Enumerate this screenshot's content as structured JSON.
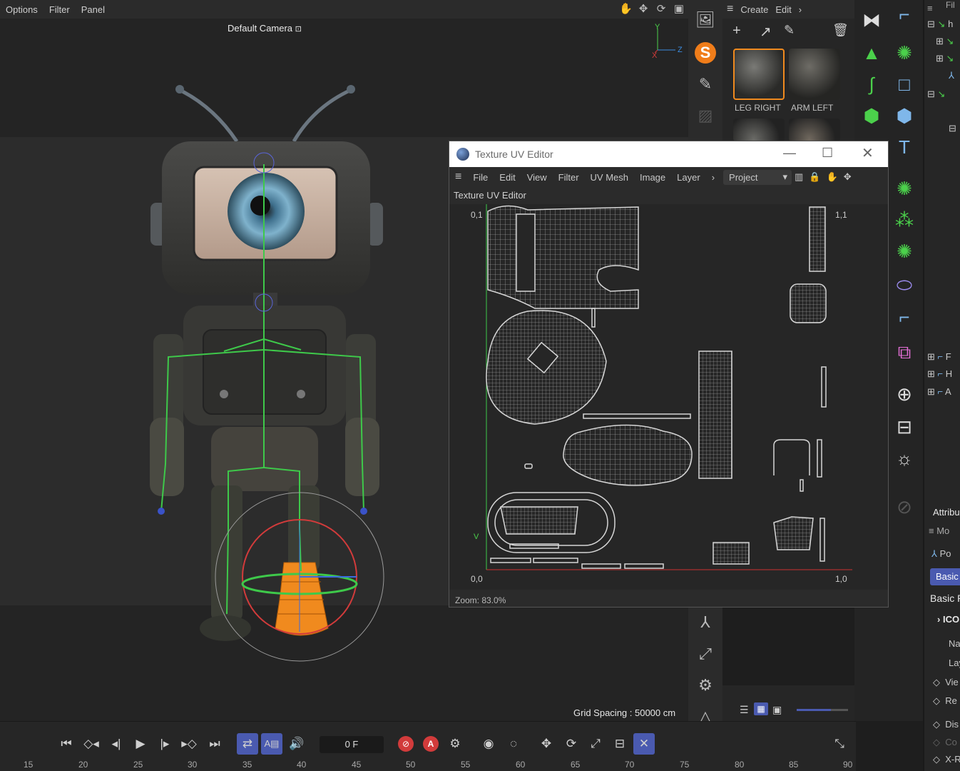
{
  "viewport": {
    "menu": [
      "Options",
      "Filter",
      "Panel"
    ],
    "camera_label": "Default Camera",
    "axis_labels": {
      "y": "Y",
      "z": "Z",
      "x": "X"
    },
    "grid_spacing": "Grid Spacing : 50000 cm"
  },
  "material_manager": {
    "menu": [
      "Create",
      "Edit"
    ],
    "materials": [
      "LEG RIGHT",
      "ARM LEFT"
    ]
  },
  "uv_editor": {
    "title": "Texture UV Editor",
    "menu": [
      "File",
      "Edit",
      "View",
      "Filter",
      "UV Mesh",
      "Image",
      "Layer"
    ],
    "layer_select": "Project",
    "subtitle": "Texture UV Editor",
    "corner_labels": {
      "top_left": "0,1",
      "top_right": "1,1",
      "bottom_left": "0,0",
      "bottom_right": "1,0"
    },
    "axis_v": "V",
    "zoom": "Zoom: 83.0%"
  },
  "object_manager": {
    "rows": [
      "Fil",
      "h",
      "F",
      "H",
      "A"
    ]
  },
  "attributes": {
    "title": "Attribu",
    "mode": "Mo",
    "object_type": "Po",
    "tab_basic": "Basic",
    "section": "Basic P",
    "group": "ICO",
    "fields": [
      "Na",
      "Lay",
      "Vie",
      "Re",
      "Dis",
      "Co",
      "X-R"
    ]
  },
  "timeline": {
    "frame": "0 F",
    "ticks": [
      "15",
      "20",
      "25",
      "30",
      "35",
      "40",
      "45",
      "50",
      "55",
      "60",
      "65",
      "70",
      "75",
      "80",
      "85",
      "90"
    ]
  },
  "colors": {
    "accent_blue": "#4a5ab0",
    "uv_lines": "#c8c8c8",
    "record_red": "#d23b3b",
    "selection_orange": "#f08a1e",
    "bone_green": "#3ec94a"
  }
}
